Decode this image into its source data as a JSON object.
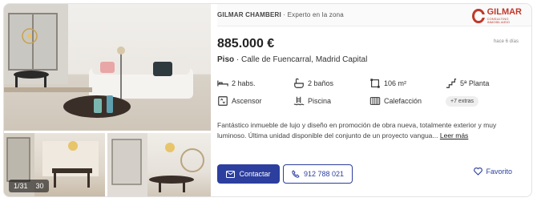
{
  "gallery": {
    "counter_current": "1/31",
    "counter_total": "30"
  },
  "agency": {
    "name": "GILMAR CHAMBERI",
    "tagline": "· Experto en la zona",
    "logo_text": "GILMAR",
    "logo_tagline": "CONSULTING INMOBILIARIO"
  },
  "listing": {
    "price": "885.000 €",
    "age": "hace 6 días",
    "type": "Piso",
    "address": "· Calle de Fuencarral, Madrid Capital",
    "features": [
      {
        "icon": "bed-icon",
        "label": "2 habs."
      },
      {
        "icon": "bath-icon",
        "label": "2 baños"
      },
      {
        "icon": "area-icon",
        "label": "106 m²"
      },
      {
        "icon": "stairs-icon",
        "label": "5ª Planta"
      },
      {
        "icon": "elevator-icon",
        "label": "Ascensor"
      },
      {
        "icon": "pool-icon",
        "label": "Piscina"
      },
      {
        "icon": "heating-icon",
        "label": "Calefacción"
      }
    ],
    "extras": "+7 extras",
    "description": "Fantástico inmueble de lujo y diseño en promoción de obra nueva, totalmente exterior y muy luminoso. Última unidad disponible del conjunto de un proyecto vangua...",
    "read_more": "Leer más"
  },
  "actions": {
    "contact": "Contactar",
    "phone": "912 788 021",
    "favorite": "Favorito"
  },
  "colors": {
    "primary": "#2c3e9e",
    "brand": "#c0392b"
  }
}
